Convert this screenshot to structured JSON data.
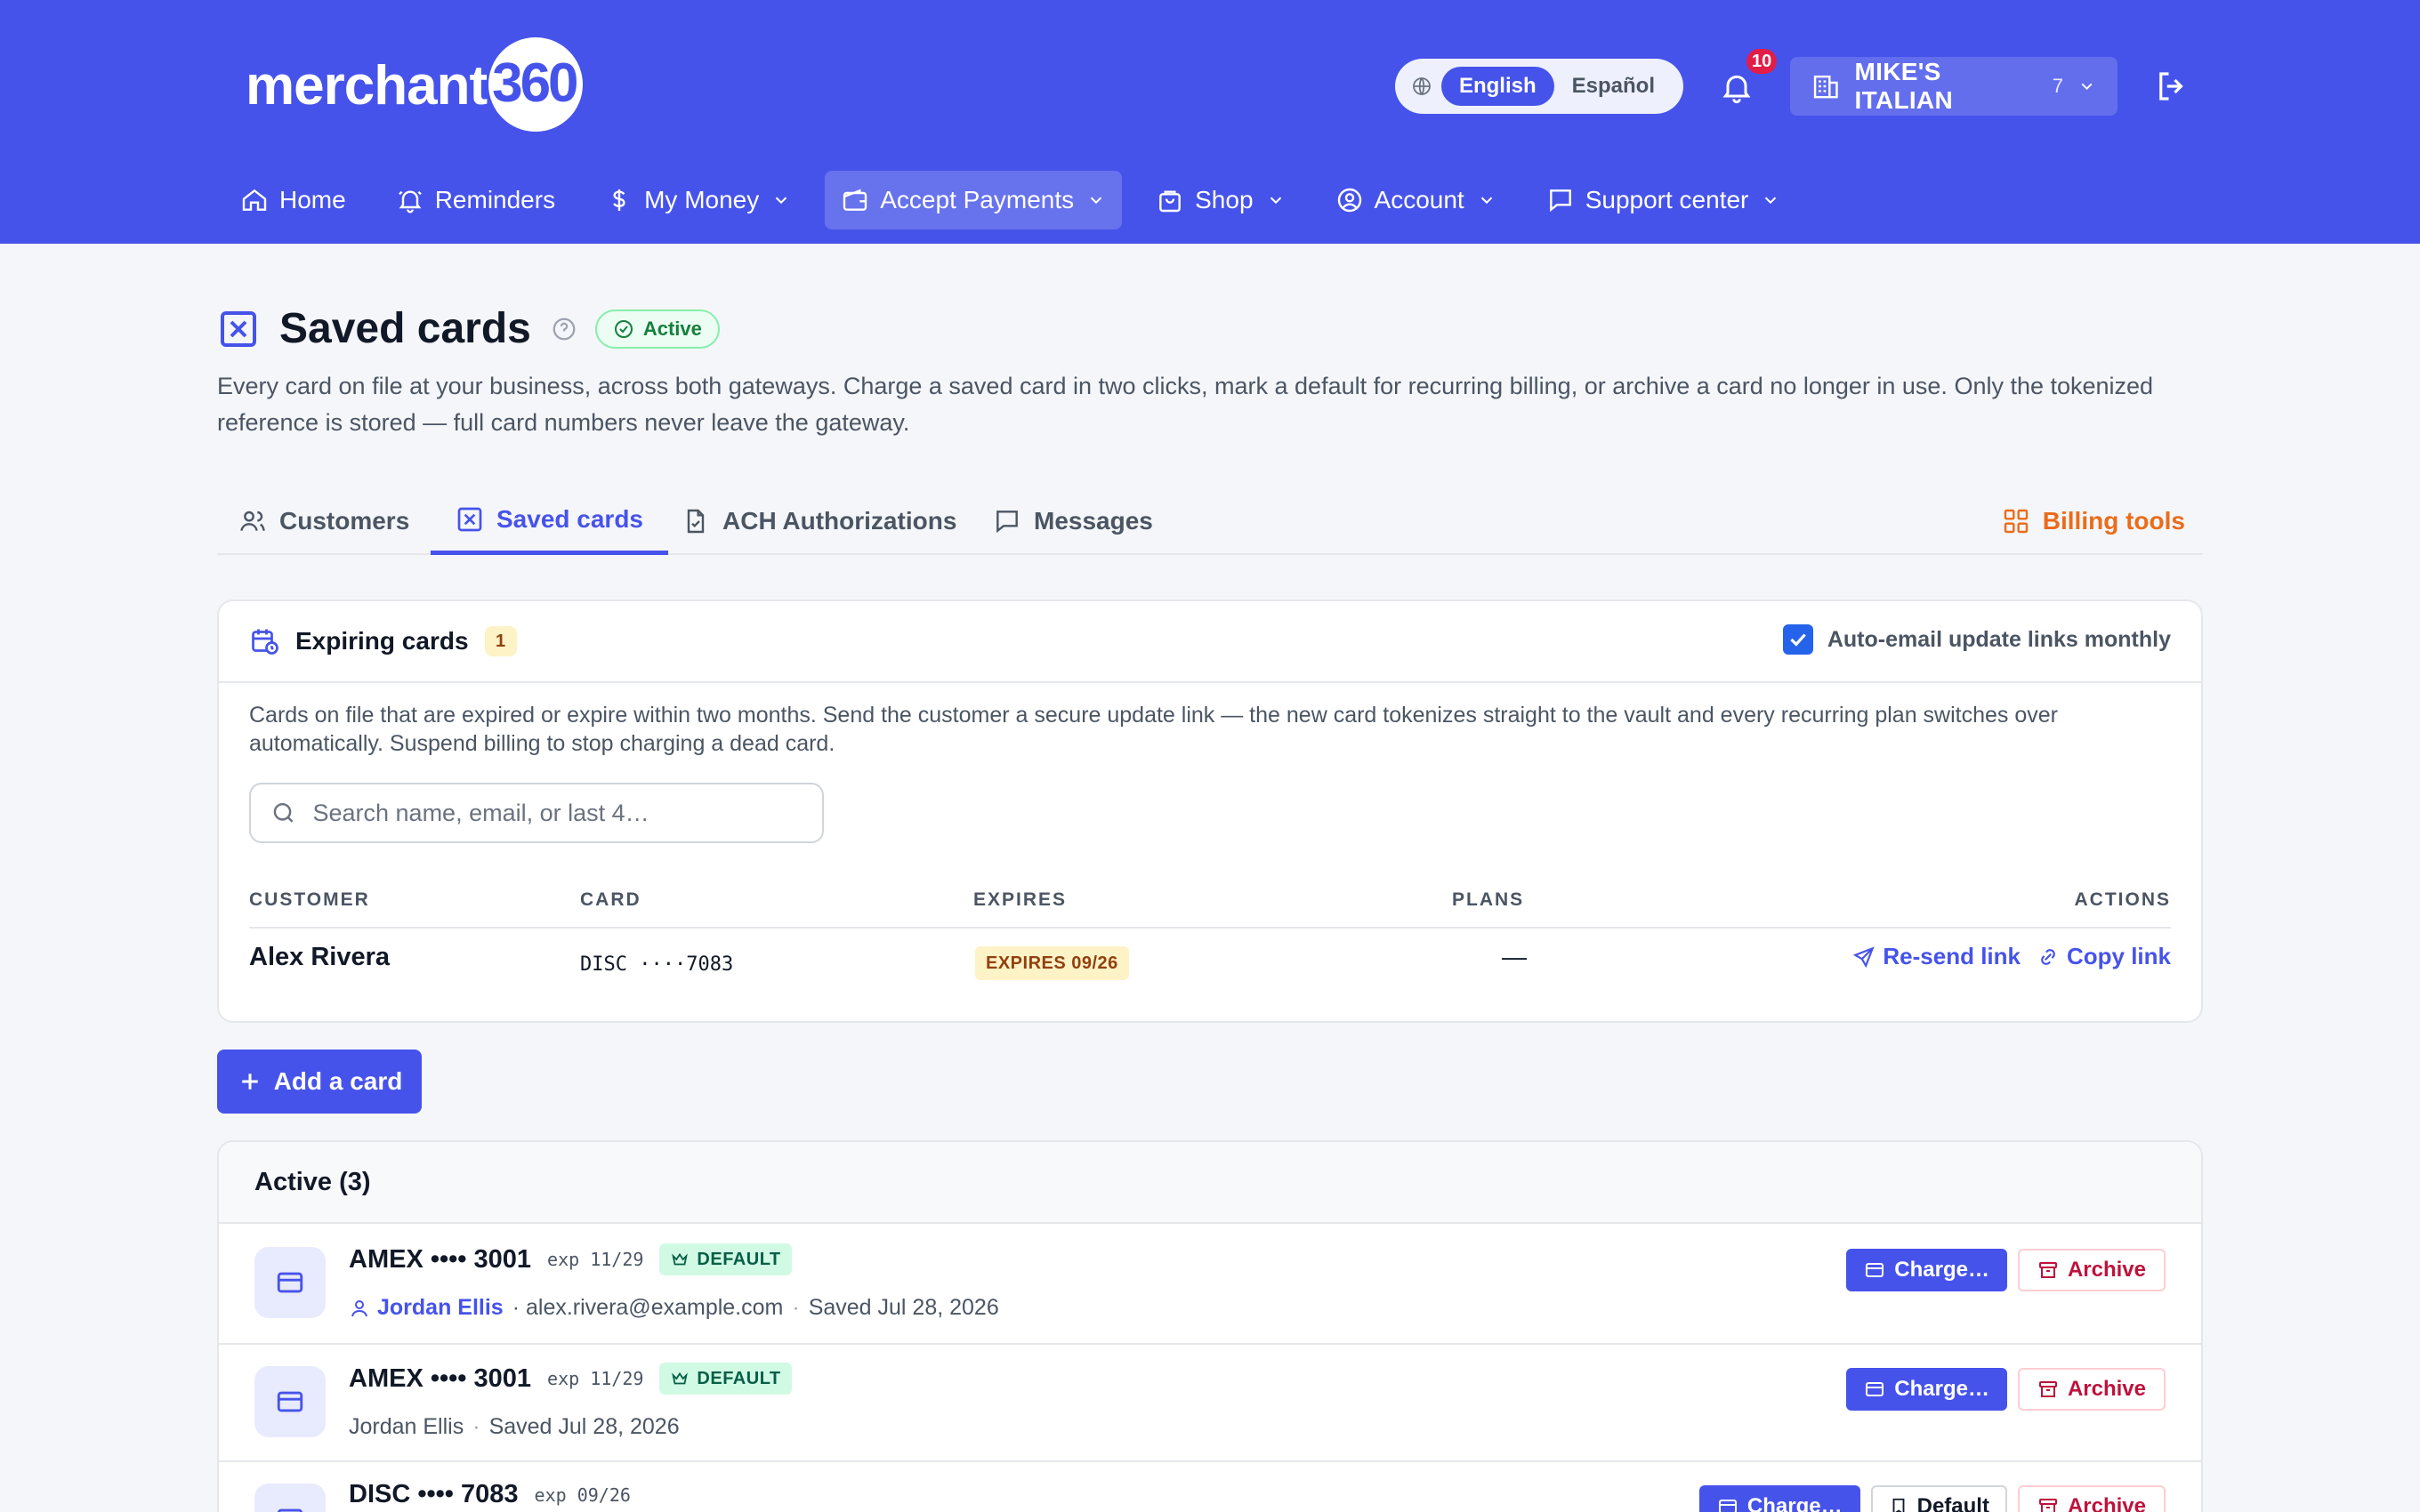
{
  "app": {
    "logo_text": "merchant",
    "logo_number": "360"
  },
  "language": {
    "options": [
      "English",
      "Español"
    ],
    "selected": "English"
  },
  "notifications": {
    "count": "10"
  },
  "business": {
    "name": "MIKE'S ITALIAN",
    "count": "7"
  },
  "nav": {
    "items": [
      {
        "label": "Home",
        "icon": "home-icon",
        "has_menu": false
      },
      {
        "label": "Reminders",
        "icon": "bell-icon",
        "has_menu": false
      },
      {
        "label": "My Money",
        "icon": "dollar-icon",
        "has_menu": true
      },
      {
        "label": "Accept Payments",
        "icon": "wallet-icon",
        "has_menu": true,
        "active": true
      },
      {
        "label": "Shop",
        "icon": "shopping-bag-icon",
        "has_menu": true
      },
      {
        "label": "Account",
        "icon": "user-circle-icon",
        "has_menu": true
      },
      {
        "label": "Support center",
        "icon": "message-icon",
        "has_menu": true
      }
    ]
  },
  "page": {
    "title": "Saved cards",
    "status": "Active",
    "description": "Every card on file at your business, across both gateways. Charge a saved card in two clicks, mark a default for recurring billing, or archive a card no longer in use. Only the tokenized reference is stored — full card numbers never leave the gateway."
  },
  "tabs": {
    "items": [
      "Customers",
      "Saved cards",
      "ACH Authorizations",
      "Messages"
    ],
    "active": "Saved cards",
    "billing_tools": "Billing tools"
  },
  "expiring": {
    "title": "Expiring cards",
    "count": "1",
    "auto_email_label": "Auto-email update links monthly",
    "auto_email_checked": true,
    "description": "Cards on file that are expired or expire within two months. Send the customer a secure update link — the new card tokenizes straight to the vault and every recurring plan switches over automatically. Suspend billing to stop charging a dead card.",
    "search_placeholder": "Search name, email, or last 4…",
    "columns": {
      "customer": "CUSTOMER",
      "card": "CARD",
      "expires": "EXPIRES",
      "plans": "PLANS",
      "actions": "ACTIONS"
    },
    "rows": [
      {
        "customer": "Alex Rivera",
        "card": "DISC ····7083",
        "expires": "EXPIRES 09/26",
        "plans": "—",
        "resend": "Re-send link",
        "copy": "Copy link"
      }
    ]
  },
  "add_card_label": "Add a card",
  "active_cards": {
    "title": "Active (3)",
    "charge_label": "Charge…",
    "archive_label": "Archive",
    "default_label": "Default",
    "default_badge": "DEFAULT",
    "rows": [
      {
        "name": "AMEX •••• 3001",
        "exp": "exp 11/29",
        "is_default": true,
        "owner": "Jordan Ellis",
        "email": "· alex.rivera@example.com",
        "saved": "Saved Jul 28, 2026"
      },
      {
        "name": "AMEX •••• 3001",
        "exp": "exp 11/29",
        "is_default": true,
        "owner": "Jordan Ellis",
        "saved": "Saved Jul 28, 2026"
      },
      {
        "name": "DISC •••• 7083",
        "exp": "exp 09/26",
        "is_default": false
      }
    ]
  },
  "colors": {
    "brand": "#4653ea",
    "warning": "#ea6c1a",
    "danger": "#be123c",
    "success": "#15803d"
  }
}
